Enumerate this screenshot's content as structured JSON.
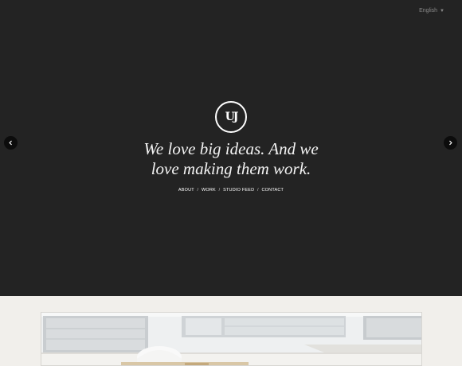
{
  "header": {
    "language": "English"
  },
  "hero": {
    "logo_text": "UJ",
    "tagline_line1": "We love big ideas. And we",
    "tagline_line2": "love making them work."
  },
  "nav": {
    "items": [
      "ABOUT",
      "WORK",
      "STUDIO FEED",
      "CONTACT"
    ],
    "separator": "/"
  },
  "colors": {
    "hero_background": "#232323",
    "page_background": "#f1efeb",
    "arrow_background": "#0c0c0c"
  },
  "icons": {
    "previous": "chevron-left-icon",
    "next": "chevron-right-icon",
    "language_caret": "caret-down-icon"
  }
}
